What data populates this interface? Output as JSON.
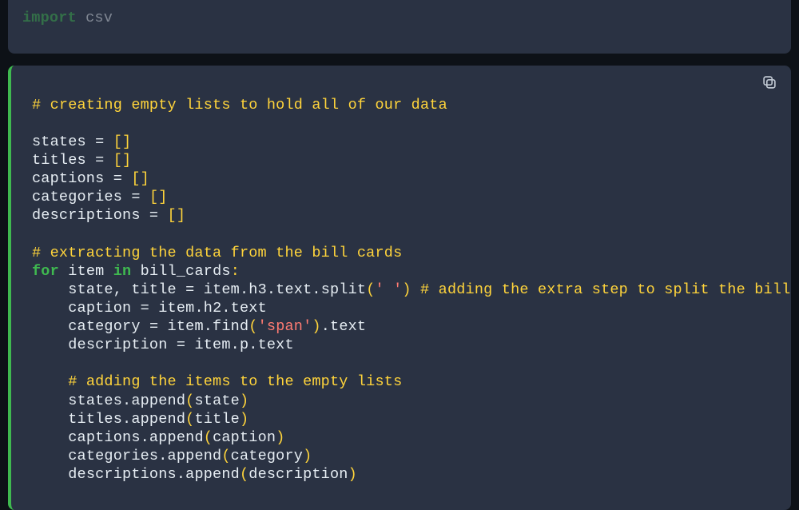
{
  "cell_top": {
    "line1": {
      "kw": "import",
      "rest": " csv"
    }
  },
  "cell_main": {
    "c1": "# creating empty lists to hold all of our data",
    "l_states": {
      "name": "states",
      "eq": " = ",
      "br": "[]"
    },
    "l_titles": {
      "name": "titles",
      "eq": " = ",
      "br": "[]"
    },
    "l_caps": {
      "name": "captions",
      "eq": " = ",
      "br": "[]"
    },
    "l_cats": {
      "name": "categories",
      "eq": " = ",
      "br": "[]"
    },
    "l_descs": {
      "name": "descriptions",
      "eq": " = ",
      "br": "[]"
    },
    "c2": "# extracting the data from the bill cards",
    "for_line": {
      "kw1": "for",
      "sp1": " ",
      "var": "item",
      "sp2": " ",
      "kw2": "in",
      "sp3": " ",
      "iter": "bill_cards",
      "colon": ":"
    },
    "split_line": {
      "indent": "    ",
      "lhs": "state, title ",
      "eq": "=",
      "mid": " item.h3.text.split",
      "lp": "(",
      "str": "' '",
      "rp": ")",
      "sp": " ",
      "cmt": "# adding the extra step to split the bill n"
    },
    "cap_line": {
      "indent": "    ",
      "lhs": "caption ",
      "eq": "=",
      "rhs": " item.h2.text"
    },
    "cat_line": {
      "indent": "    ",
      "lhs": "category ",
      "eq": "=",
      "mid": " item.find",
      "lp": "(",
      "str": "'span'",
      "rp": ")",
      "tail": ".text"
    },
    "desc_line": {
      "indent": "    ",
      "lhs": "description ",
      "eq": "=",
      "rhs": " item.p.text"
    },
    "c3_indent": "    ",
    "c3": "# adding the items to the empty lists",
    "ap1": {
      "indent": "    ",
      "obj": "states.append",
      "lp": "(",
      "arg": "state",
      "rp": ")"
    },
    "ap2": {
      "indent": "    ",
      "obj": "titles.append",
      "lp": "(",
      "arg": "title",
      "rp": ")"
    },
    "ap3": {
      "indent": "    ",
      "obj": "captions.append",
      "lp": "(",
      "arg": "caption",
      "rp": ")"
    },
    "ap4": {
      "indent": "    ",
      "obj": "categories.append",
      "lp": "(",
      "arg": "category",
      "rp": ")"
    },
    "ap5": {
      "indent": "    ",
      "obj": "descriptions.append",
      "lp": "(",
      "arg": "description",
      "rp": ")"
    }
  }
}
